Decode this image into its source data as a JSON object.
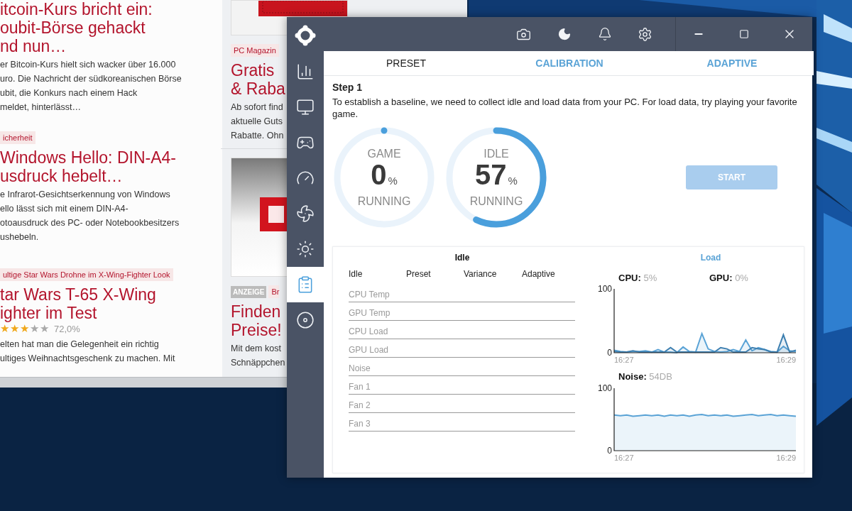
{
  "browser": {
    "left_articles": [
      {
        "headline_lines": [
          "itcoin-Kurs bricht ein:",
          "oubit-Börse gehackt",
          "nd nun…"
        ],
        "body_lines": [
          "er Bitcoin-Kurs hielt sich wacker über 16.000",
          "uro. Die Nachricht der südkoreanischen Börse",
          "ubit, die Konkurs nach einem Hack",
          "meldet, hinterlässt…"
        ]
      },
      {
        "tag": "icherheit",
        "headline_lines": [
          "Windows Hello: DIN-A4-",
          "usdruck hebelt…"
        ],
        "body_lines": [
          "e Infrarot-Gesichtserkennung von Windows",
          "ello lässt sich mit einem DIN-A4-",
          "otoausdruck des PC- oder Notebookbesitzers",
          "ushebeln."
        ]
      },
      {
        "tag": "ultige Star Wars Drohne im X-Wing-Fighter Look",
        "headline_lines": [
          "tar Wars T-65 X-Wing",
          "ighter im Test"
        ],
        "rating": {
          "stars": 3,
          "score": "72,0%"
        },
        "body_lines": [
          "elten hat man die Gelegenheit ein richtig",
          "ultiges Weihnachtsgeschenk zu machen. Mit"
        ]
      }
    ],
    "right_articles": [
      {
        "tag": "PC Magazin",
        "headline_lines": [
          "Gratis",
          "& Raba"
        ],
        "body_lines": [
          "Ab sofort find",
          "aktuelle Guts",
          "Rabatte. Ohn"
        ]
      },
      {
        "badge": "ANZEIGE",
        "tag": "Br",
        "headline_lines": [
          "Finden",
          "Preise!"
        ],
        "body_lines": [
          "Mit dem kost",
          "Schnäppchen"
        ]
      }
    ]
  },
  "app": {
    "sidebar": {
      "items": [
        {
          "selected": false
        },
        {
          "selected": false
        },
        {
          "selected": false
        },
        {
          "selected": false
        },
        {
          "selected": false
        },
        {
          "selected": false
        },
        {
          "selected": true
        },
        {
          "selected": false
        }
      ]
    },
    "tabs": [
      {
        "label": "PRESET",
        "selected": true
      },
      {
        "label": "CALIBRATION",
        "selected": false
      },
      {
        "label": "ADAPTIVE",
        "selected": false
      }
    ],
    "step": {
      "title": "Step 1",
      "text": "To establish a baseline, we need to collect idle and load data from your PC. For load data, try playing your favorite game."
    },
    "rings": [
      {
        "label": "GAME",
        "value": "0",
        "unit": "%",
        "status": "RUNNING",
        "level": 0
      },
      {
        "label": "IDLE",
        "value": "57",
        "unit": "%",
        "status": "RUNNING",
        "level": 0.57
      }
    ],
    "start_button": {
      "label": "START",
      "disabled": true
    },
    "table": {
      "title": "Idle",
      "columns": [
        "Idle",
        "Preset",
        "Variance",
        "Adaptive"
      ],
      "rows": [
        "CPU Temp",
        "GPU Temp",
        "CPU Load",
        "GPU Load",
        "Noise",
        "Fan 1",
        "Fan 2",
        "Fan 3"
      ]
    },
    "load": {
      "title": "Load",
      "readings": [
        {
          "label": "CPU:",
          "value": "5%"
        },
        {
          "label": "GPU:",
          "value": "0%"
        }
      ],
      "time_labels": [
        "16:27",
        "16:29"
      ],
      "chart_data": {
        "type": "area",
        "ylim": [
          0,
          100
        ],
        "yticks": [
          0,
          100
        ],
        "series": [
          {
            "color": "#5aa3d6",
            "values": [
              4,
              2,
              1,
              2,
              2,
              3,
              1,
              5,
              1,
              1,
              0,
              9,
              2,
              1,
              30,
              6,
              2,
              1,
              2,
              5,
              2,
              20,
              3,
              8,
              5,
              2,
              1,
              10,
              3,
              2
            ]
          },
          {
            "color": "#3d7fb0",
            "values": [
              2,
              1,
              1,
              3,
              1,
              1,
              1,
              1,
              1,
              8,
              1,
              1,
              1,
              1,
              1,
              1,
              1,
              8,
              6,
              1,
              1,
              1,
              8,
              6,
              5,
              1,
              1,
              28,
              1,
              4
            ]
          }
        ]
      }
    },
    "noise": {
      "label": "Noise:",
      "value": "54DB",
      "time_labels": [
        "16:27",
        "16:29"
      ],
      "chart_data": {
        "type": "area",
        "ylim": [
          0,
          100
        ],
        "yticks": [
          0,
          100
        ],
        "series": [
          {
            "color": "#5aa3d6",
            "values": [
              57,
              56,
              57,
              55,
              56,
              57,
              56,
              57,
              55,
              57,
              56,
              57,
              55,
              57,
              58,
              56,
              57,
              56,
              57,
              55,
              56,
              57,
              58,
              56,
              57,
              58,
              56,
              57,
              56,
              55
            ]
          }
        ]
      }
    }
  }
}
